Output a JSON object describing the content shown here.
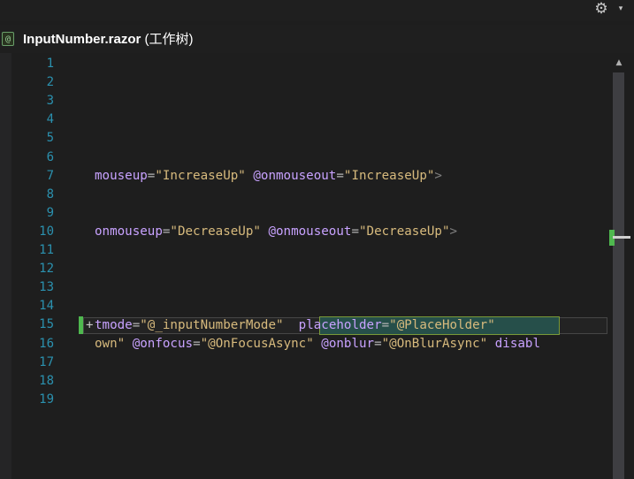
{
  "toolbar": {
    "settings_icon": "gear-icon",
    "settings_glyph": "⚙",
    "dropdown_glyph": "▾"
  },
  "document": {
    "file_icon_glyph": "@",
    "file_name": "InputNumber.razor",
    "file_suffix": " (工作树)"
  },
  "editor": {
    "line_numbers": [
      "1",
      "2",
      "3",
      "4",
      "5",
      "6",
      "7",
      "8",
      "9",
      "10",
      "11",
      "12",
      "13",
      "14",
      "15",
      "16",
      "17",
      "18",
      "19"
    ],
    "change_marker": "+",
    "lines": {
      "l7": {
        "a1": "mouseup",
        "v1": "\"IncreaseUp\"",
        "a2": "@onmouseout",
        "v2": "\"IncreaseUp\"",
        "end": ">"
      },
      "l10": {
        "a1": "onmouseup",
        "v1": "\"DecreaseUp\"",
        "a2": "@onmouseout",
        "v2": "\"DecreaseUp\"",
        "end": ">"
      },
      "l15": {
        "a1": "tmode",
        "v1": "\"@_inputNumberMode\"",
        "a2": "placeholder",
        "v2": "\"@PlaceHolder\""
      },
      "l16": {
        "p0": "own\"",
        "a1": "@onfocus",
        "v1": "\"@OnFocusAsync\"",
        "a2": "@onblur",
        "v2": "\"@OnBlurAsync\"",
        "a3": "disabl"
      }
    }
  },
  "scrollbar": {
    "up_glyph": "▲"
  }
}
